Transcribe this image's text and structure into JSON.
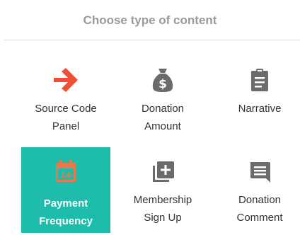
{
  "header": {
    "title": "Choose type of content"
  },
  "tiles": [
    {
      "line1": "Source Code",
      "line2": "Panel",
      "icon": "arrow-right-icon",
      "color": "#f04e37",
      "selected": false
    },
    {
      "line1": "Donation",
      "line2": "Amount",
      "icon": "money-bag-icon",
      "color": "#6b6b6b",
      "selected": false
    },
    {
      "line1": "Narrative",
      "line2": "",
      "icon": "clipboard-icon",
      "color": "#6b6b6b",
      "selected": false
    },
    {
      "line1": "Payment",
      "line2": "Frequency",
      "icon": "calendar-icon",
      "color": "#e8794a",
      "selected": true
    },
    {
      "line1": "Membership",
      "line2": "Sign Up",
      "icon": "library-add-icon",
      "color": "#6b6b6b",
      "selected": false
    },
    {
      "line1": "Donation",
      "line2": "Comment",
      "icon": "comment-icon",
      "color": "#6b6b6b",
      "selected": false
    }
  ],
  "colors": {
    "selected_bg": "#1dbcab",
    "title": "#9a9a9a"
  }
}
